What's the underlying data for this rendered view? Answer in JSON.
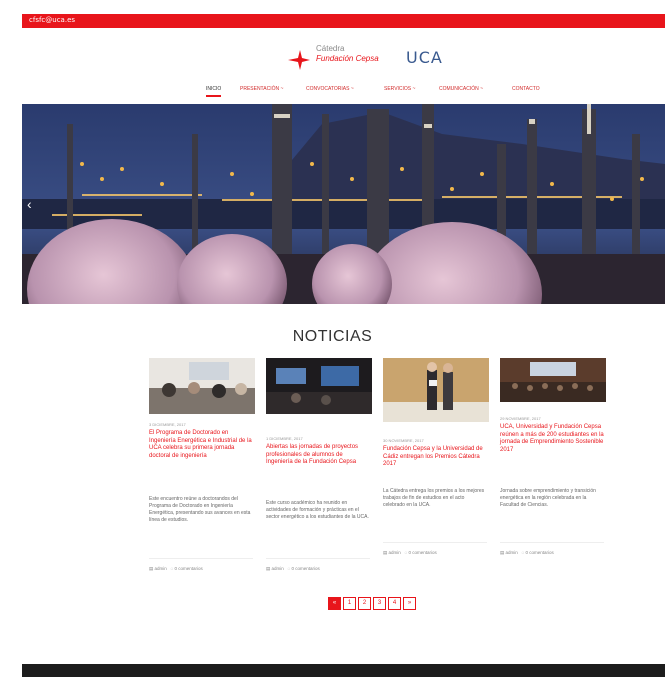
{
  "topbar": {
    "email": "cfsfc@uca.es"
  },
  "logo": {
    "line1": "Cátedra",
    "line2": "Fundación Cepsa",
    "uca": "UCA"
  },
  "nav": {
    "items": [
      "INICIO",
      "PRESENTACIÓN ~",
      "CONVOCATORIAS ~",
      "SERVICIOS ~",
      "COMUNICACIÓN ~",
      "CONTACTO"
    ]
  },
  "hero": {
    "image": "refinery-at-night"
  },
  "section_title": "NOTICIAS",
  "news": [
    {
      "date": "3 DICIEMBRE, 2017",
      "title": "El Programa de Doctorado en Ingeniería Energética e Industrial de la UCA celebra su primera jornada doctoral de ingeniería",
      "excerpt": "Este encuentro reúne a doctorandos del Programa de Doctorado en Ingeniería Energética, presentando sus avances en esta línea de estudios.",
      "author": "admin",
      "comments": "0 comentarios"
    },
    {
      "date": "1 DICIEMBRE, 2017",
      "title": "Abiertas las jornadas de proyectos profesionales de alumnos de Ingeniería de la Fundación Cepsa",
      "excerpt": "Este curso académico ha reunido en actividades de formación y prácticas en el sector energético a los estudiantes de la UCA.",
      "author": "admin",
      "comments": "0 comentarios"
    },
    {
      "date": "30 NOVIEMBRE, 2017",
      "title": "Fundación Cepsa y la Universidad de Cádiz entregan los Premios Cátedra 2017",
      "excerpt": "La Cátedra entrega los premios a los mejores trabajos de fin de estudios en el acto celebrado en la UCA.",
      "author": "admin",
      "comments": "0 comentarios"
    },
    {
      "date": "29 NOVIEMBRE, 2017",
      "title": "UCA, Universidad y Fundación Cepsa reúnen a más de 200 estudiantes en la jornada de Emprendimiento Sostenible 2017",
      "excerpt": "Jornada sobre emprendimiento y transición energética en la región celebrada en la Facultad de Ciencias.",
      "author": "admin",
      "comments": "0 comentarios"
    }
  ],
  "pagination": [
    "«",
    "1",
    "2",
    "3",
    "4",
    "»"
  ],
  "colors": {
    "brand_red": "#e8151b",
    "footer": "#1d1d1d"
  }
}
